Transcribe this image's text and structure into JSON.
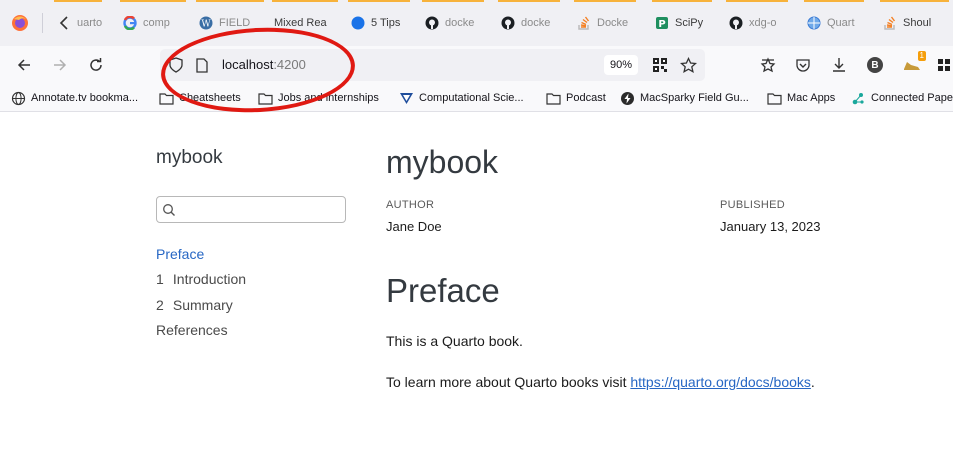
{
  "browser": {
    "tabs": [
      {
        "title": "uarto",
        "icon": "chevron-left-icon"
      },
      {
        "title": "comp",
        "icon": "google-icon"
      },
      {
        "title": "FIELD",
        "icon": "wordpress-icon"
      },
      {
        "title": "Mixed Rea",
        "icon": ""
      },
      {
        "title": "5 Tips",
        "icon": "blue-dot-icon"
      },
      {
        "title": "docke",
        "icon": "github-icon"
      },
      {
        "title": "docke",
        "icon": "github-icon"
      },
      {
        "title": "Docke",
        "icon": "stackoverflow-icon"
      },
      {
        "title": "SciPy",
        "icon": "pypi-icon"
      },
      {
        "title": "xdg-o",
        "icon": "github-icon"
      },
      {
        "title": "Quart",
        "icon": "globe-icon"
      },
      {
        "title": "Shoul",
        "icon": "stackoverflow-icon"
      }
    ],
    "url": {
      "host": "localhost",
      "port": ":4200"
    },
    "zoom": "90%",
    "bookmarks": [
      {
        "label": "Annotate.tv bookma...",
        "icon": "globe-icon"
      },
      {
        "label": "Cheatsheets",
        "icon": "folder-icon"
      },
      {
        "label": "Jobs and internships",
        "icon": "folder-icon"
      },
      {
        "label": "Computational Scie...",
        "icon": "vector-icon"
      },
      {
        "label": "Podcast",
        "icon": "folder-icon"
      },
      {
        "label": "MacSparky Field Gu...",
        "icon": "bolt-icon"
      },
      {
        "label": "Mac Apps",
        "icon": "folder-icon"
      },
      {
        "label": "Connected Pape",
        "icon": "graph-icon"
      }
    ],
    "toolbar_badge": "B",
    "extension_badge": "1",
    "annotation_color": "#e01912"
  },
  "sidebar": {
    "title": "mybook",
    "search_placeholder": "",
    "items": [
      {
        "num": "",
        "label": "Preface",
        "active": true
      },
      {
        "num": "1",
        "label": "Introduction",
        "active": false
      },
      {
        "num": "2",
        "label": "Summary",
        "active": false
      },
      {
        "num": "",
        "label": "References",
        "active": false
      }
    ]
  },
  "main": {
    "title": "mybook",
    "author_label": "AUTHOR",
    "author": "Jane Doe",
    "published_label": "PUBLISHED",
    "published": "January 13, 2023",
    "section_heading": "Preface",
    "para1": "This is a Quarto book.",
    "para2_prefix": "To learn more about Quarto books visit ",
    "para2_link": "https://quarto.org/docs/books",
    "para2_suffix": ".",
    "link_color": "#2767c4"
  }
}
